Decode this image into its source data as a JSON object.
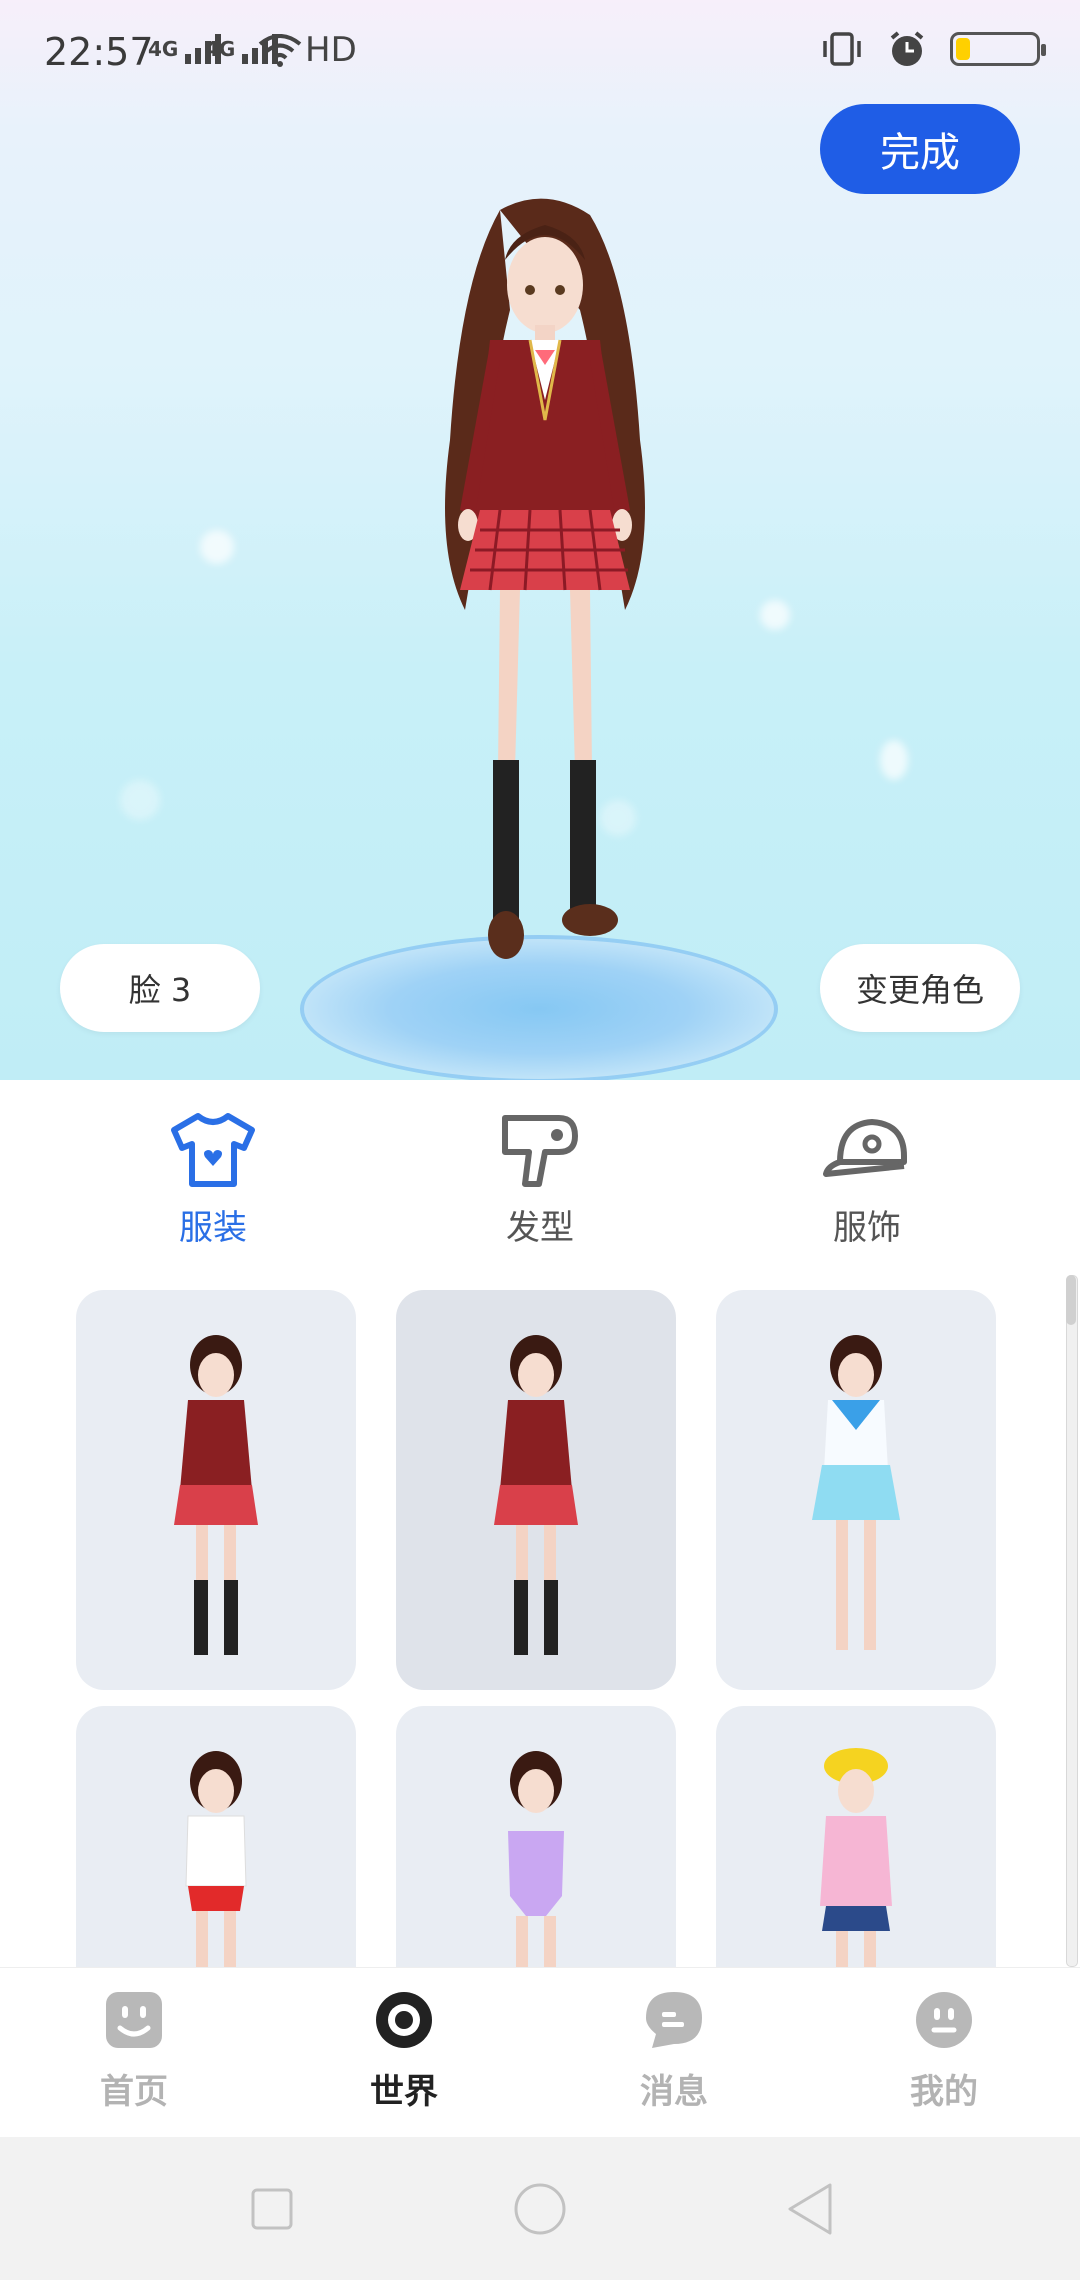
{
  "status_bar": {
    "time": "22:57",
    "signal_1": "4G",
    "signal_2": "4G",
    "hd": "HD",
    "battery_level": 0.18
  },
  "top": {
    "done_label": "完成",
    "face_label": "脸 3",
    "change_role_label": "变更角色"
  },
  "category_tabs": [
    {
      "label": "服装",
      "icon": "tshirt-icon",
      "active": true
    },
    {
      "label": "发型",
      "icon": "hair-dryer-icon",
      "active": false
    },
    {
      "label": "服饰",
      "icon": "cap-icon",
      "active": false
    }
  ],
  "outfits": [
    {
      "name": "red-blazer-uniform",
      "selected": false
    },
    {
      "name": "red-blazer-uniform-alt",
      "selected": true
    },
    {
      "name": "sailor-uniform",
      "selected": false
    },
    {
      "name": "gym-outfit",
      "selected": false
    },
    {
      "name": "swimsuit",
      "selected": false
    },
    {
      "name": "kindergarten-outfit",
      "selected": false
    }
  ],
  "bottom_nav": [
    {
      "label": "首页",
      "icon": "home-face-icon",
      "active": false
    },
    {
      "label": "世界",
      "icon": "world-target-icon",
      "active": true
    },
    {
      "label": "消息",
      "icon": "message-bubble-icon",
      "active": false
    },
    {
      "label": "我的",
      "icon": "smiley-icon",
      "active": false
    }
  ],
  "colors": {
    "accent": "#2a6fe6",
    "done_button": "#1f5de6",
    "card_bg": "#e9edf3"
  }
}
